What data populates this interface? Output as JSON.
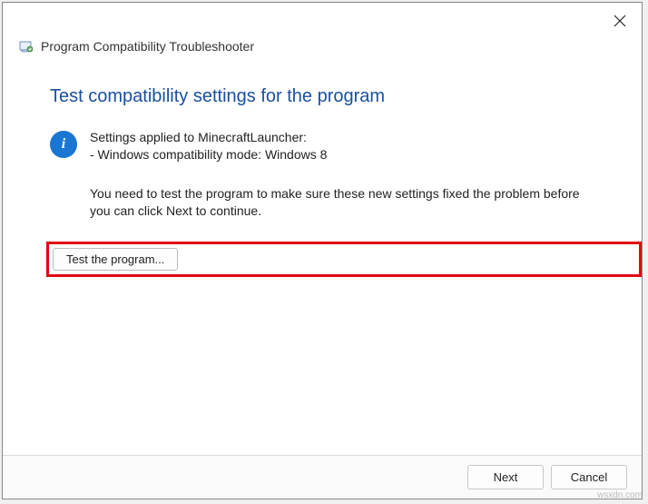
{
  "header": {
    "title": "Program Compatibility Troubleshooter"
  },
  "main": {
    "heading": "Test compatibility settings for the program",
    "info_line1": "Settings applied to MinecraftLauncher:",
    "info_line2": "- Windows compatibility mode: Windows 8",
    "instruction": "You need to test the program to make sure these new settings fixed the problem before you can click Next to continue.",
    "test_button_label": "Test the program..."
  },
  "footer": {
    "next_label": "Next",
    "cancel_label": "Cancel"
  },
  "watermark": "wsxdn.com"
}
